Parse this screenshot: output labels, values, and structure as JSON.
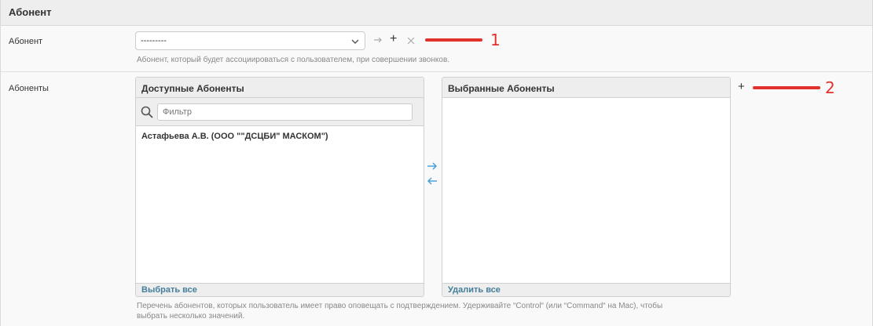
{
  "section": {
    "title": "Абонент"
  },
  "abonent_field": {
    "label": "Абонент",
    "selected_value": "---------",
    "help_text": "Абонент, который будет ассоциироваться с пользователем, при совершении звонков.",
    "icons": {
      "dropdown": "chevron-down-icon",
      "change": "arrow-right-icon",
      "add": "plus-icon",
      "delete": "close-icon"
    }
  },
  "abonents_field": {
    "label": "Абоненты",
    "available": {
      "title": "Доступные Абоненты",
      "filter_placeholder": "Фильтр",
      "items": [
        "Астафьева А.В. (ООО \"\"ДСЦБИ\" МАСКОМ\")"
      ],
      "footer_link": "Выбрать все"
    },
    "chosen": {
      "title": "Выбранные Абоненты",
      "items": [],
      "footer_link": "Удалить все"
    },
    "help_text_line1": "Перечень абонентов, которых пользователь имеет право оповещать с подтверждением. Удерживайте “Control“ (или “Command“ на Mac), чтобы",
    "help_text_line2": "выбрать несколько значений."
  },
  "annotations": {
    "marker_1": "1",
    "marker_2": "2",
    "color": "#e0312a"
  },
  "colors": {
    "link": "#447e9b",
    "move_arrow": "#4aa3d8",
    "header_bg": "#eeeeee"
  }
}
